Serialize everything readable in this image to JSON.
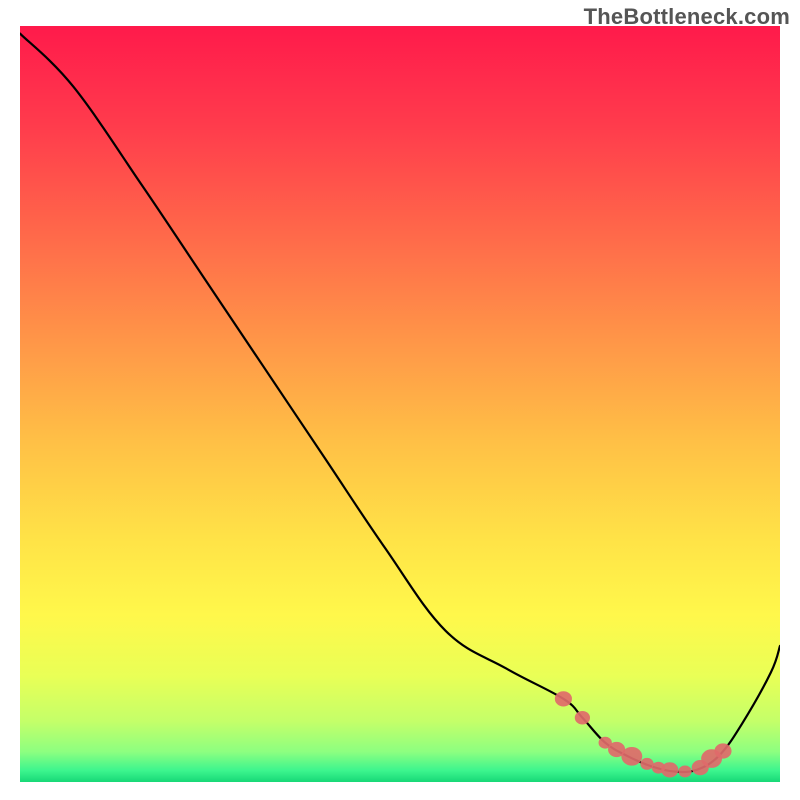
{
  "watermark": "TheBottleneck.com",
  "chart_data": {
    "type": "line",
    "title": "",
    "xlabel": "",
    "ylabel": "",
    "xlim": [
      0,
      100
    ],
    "ylim": [
      0,
      100
    ],
    "series": [
      {
        "name": "curve",
        "color": "#000000",
        "x": [
          0,
          7,
          16,
          24,
          32,
          40,
          48,
          56,
          64,
          71.5,
          74,
          77,
          80,
          83,
          86,
          89,
          92,
          95,
          98.8,
          100
        ],
        "y": [
          99,
          92,
          79,
          67,
          55,
          43,
          31,
          20,
          15,
          11,
          8.5,
          5.2,
          3.4,
          2.1,
          1.4,
          1.6,
          3.5,
          7.7,
          14.5,
          18
        ]
      },
      {
        "name": "dots",
        "color": "#e06a6a",
        "type": "scatter",
        "size": [
          9,
          8,
          7,
          9,
          11,
          7,
          7,
          9,
          7,
          9,
          11,
          9
        ],
        "x": [
          71.5,
          74.0,
          77.0,
          78.5,
          80.5,
          82.5,
          84.0,
          85.5,
          87.5,
          89.5,
          91.0,
          92.5
        ],
        "y": [
          11.0,
          8.5,
          5.2,
          4.3,
          3.4,
          2.4,
          1.9,
          1.6,
          1.4,
          1.9,
          3.1,
          4.1
        ]
      }
    ],
    "gradient_stops": [
      {
        "offset": 0.0,
        "color": "#ff1a4b"
      },
      {
        "offset": 0.13,
        "color": "#ff3b4c"
      },
      {
        "offset": 0.28,
        "color": "#ff6a4a"
      },
      {
        "offset": 0.42,
        "color": "#ff9748"
      },
      {
        "offset": 0.55,
        "color": "#ffc046"
      },
      {
        "offset": 0.68,
        "color": "#ffe347"
      },
      {
        "offset": 0.78,
        "color": "#fff84b"
      },
      {
        "offset": 0.86,
        "color": "#e9ff56"
      },
      {
        "offset": 0.92,
        "color": "#c4ff69"
      },
      {
        "offset": 0.96,
        "color": "#8dff80"
      },
      {
        "offset": 0.985,
        "color": "#3cf58e"
      },
      {
        "offset": 1.0,
        "color": "#17d877"
      }
    ]
  }
}
